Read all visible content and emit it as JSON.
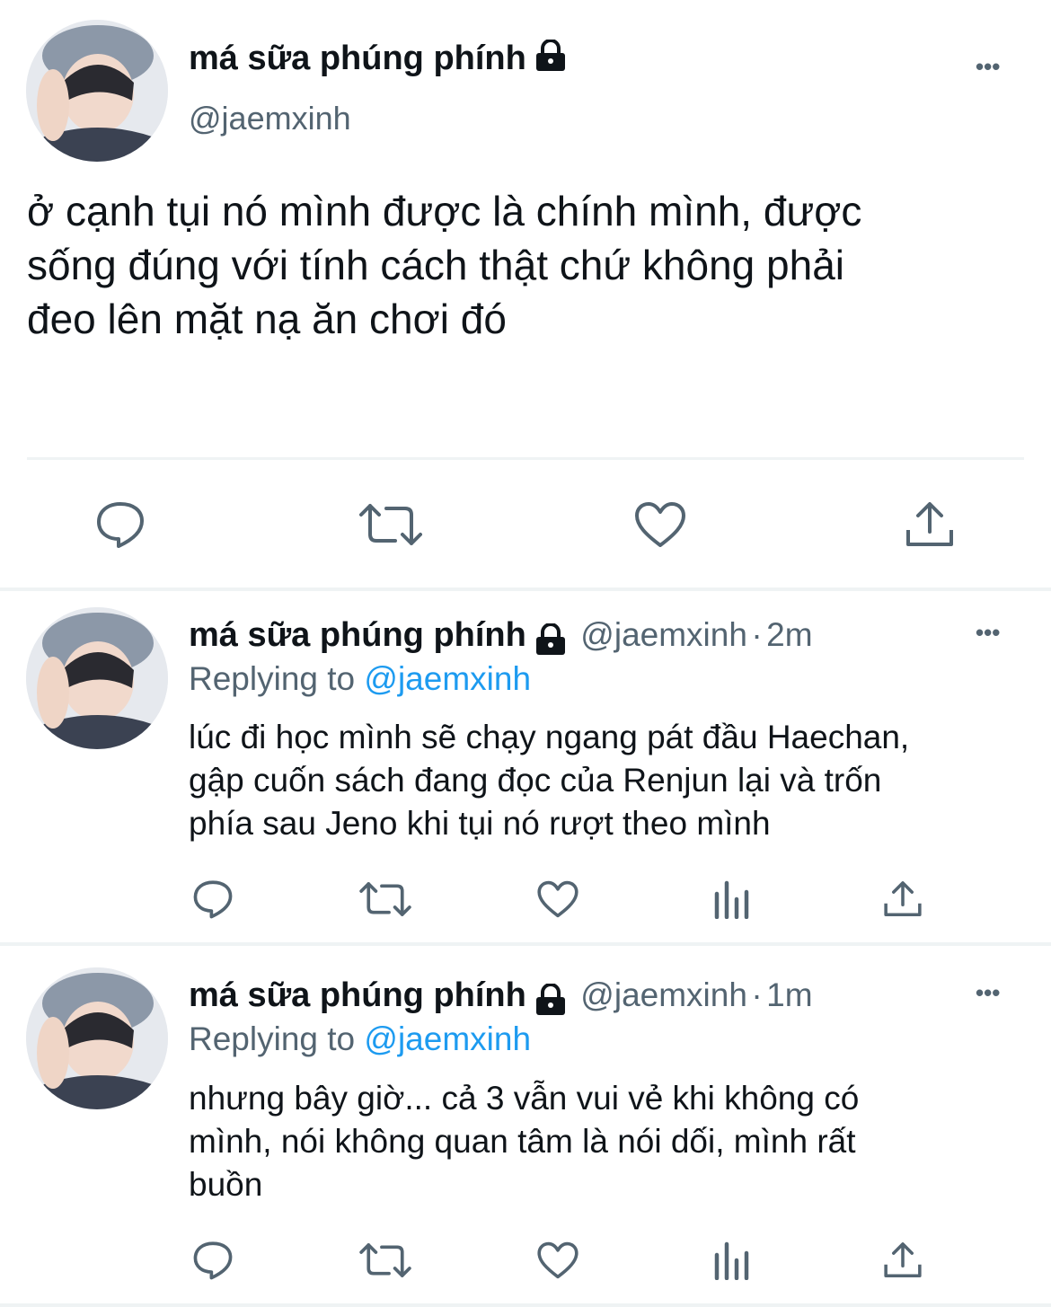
{
  "main_tweet": {
    "display_name": "má sữa phúng phính",
    "handle": "@jaemxinh",
    "text_lines": [
      "ở cạnh tụi nó mình được là chính mình, được",
      "sống đúng với tính cách thật chứ không phải",
      "đeo lên mặt nạ ăn chơi đó"
    ],
    "more_label": "•••"
  },
  "replies": [
    {
      "display_name": "má sữa phúng phính",
      "handle": "@jaemxinh",
      "separator": "·",
      "time": "2m",
      "replying_prefix": "Replying to",
      "replying_handle": "@jaemxinh",
      "text_lines": [
        "lúc đi học mình sẽ chạy ngang pát đầu Haechan,",
        "gập cuốn sách đang đọc của Renjun lại và trốn",
        "phía sau Jeno khi tụi nó rượt theo mình"
      ],
      "more_label": "•••"
    },
    {
      "display_name": "má sữa phúng phính",
      "handle": "@jaemxinh",
      "separator": "·",
      "time": "1m",
      "replying_prefix": "Replying to",
      "replying_handle": "@jaemxinh",
      "text_lines": [
        "nhưng bây giờ... cả 3 vẫn vui vẻ khi không có",
        "mình, nói không quan tâm là nói dối, mình rất",
        "buồn"
      ],
      "more_label": "•••"
    }
  ],
  "icons": {
    "reply": "reply-icon",
    "retweet": "retweet-icon",
    "like": "like-icon",
    "analytics": "analytics-icon",
    "share": "share-icon",
    "lock": "lock-icon",
    "more": "more-icon"
  },
  "colors": {
    "text": "#0f1419",
    "secondary": "#536471",
    "link": "#1d9bf0",
    "divider": "#eff3f4"
  }
}
